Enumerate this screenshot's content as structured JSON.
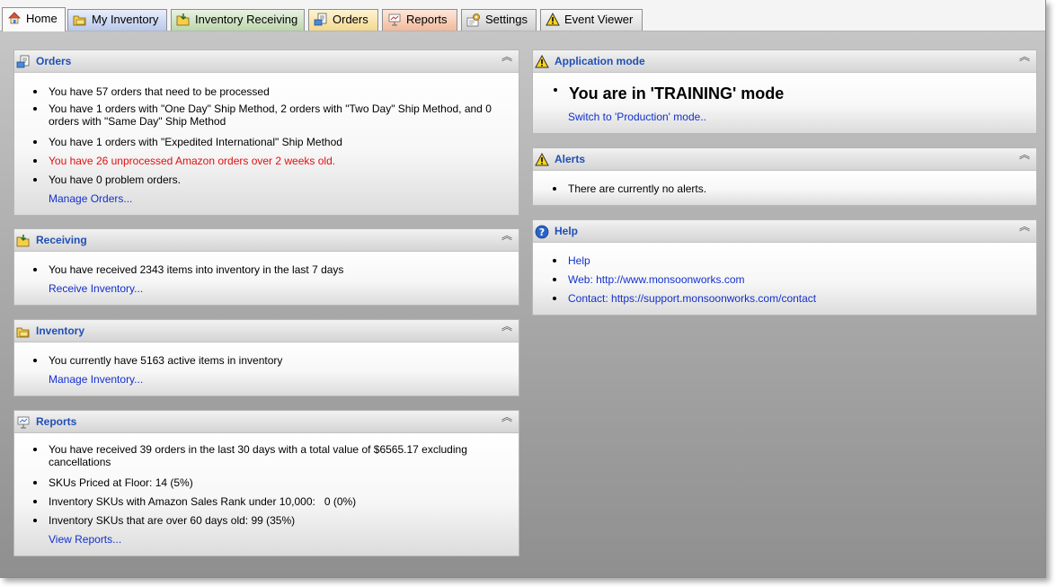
{
  "tabs": [
    {
      "label": "Home",
      "icon": "home-icon"
    },
    {
      "label": "My Inventory",
      "icon": "inventory-folder-icon"
    },
    {
      "label": "Inventory Receiving",
      "icon": "receiving-folder-icon"
    },
    {
      "label": "Orders",
      "icon": "orders-icon"
    },
    {
      "label": "Reports",
      "icon": "reports-icon"
    },
    {
      "label": "Settings",
      "icon": "settings-icon"
    },
    {
      "label": "Event Viewer",
      "icon": "warning-icon"
    }
  ],
  "orders": {
    "title": "Orders",
    "items": [
      "You have 57 orders that need to be processed",
      "You have 1 orders with \"One Day\" Ship Method, 2 orders with \"Two Day\" Ship Method, and 0 orders with \"Same Day\" Ship Method",
      "You have 1 orders with \"Expedited International\" Ship Method",
      "You have 26 unprocessed Amazon orders over 2 weeks old.",
      "You have 0 problem orders."
    ],
    "link": "Manage Orders..."
  },
  "receiving": {
    "title": "Receiving",
    "items": [
      "You have received 2343 items into inventory in the last 7 days"
    ],
    "link": "Receive Inventory..."
  },
  "inventory": {
    "title": "Inventory",
    "items": [
      "You currently have 5163 active items in inventory"
    ],
    "link": "Manage Inventory..."
  },
  "reports": {
    "title": "Reports",
    "items": [
      "You have received 39 orders in the last 30 days with a total value of $6565.17 excluding cancellations",
      "SKUs Priced at Floor: 14 (5%)",
      "Inventory SKUs with Amazon Sales Rank under 10,000:   0 (0%)",
      "Inventory SKUs that are over 60 days old: 99 (35%)"
    ],
    "link": "View Reports..."
  },
  "app_mode": {
    "title": "Application mode",
    "mode_text": "You are in 'TRAINING' mode",
    "link": "Switch to 'Production' mode.."
  },
  "alerts": {
    "title": "Alerts",
    "items": [
      "There are currently no alerts."
    ]
  },
  "help": {
    "title": "Help",
    "links": [
      "Help",
      "Web: http://www.monsoonworks.com",
      "Contact: https://support.monsoonworks.com/contact"
    ]
  },
  "collapse_glyph": "︽",
  "colors": {
    "title_blue": "#1f4fb5",
    "link_blue": "#1330cc",
    "warning_red": "#e01010"
  }
}
